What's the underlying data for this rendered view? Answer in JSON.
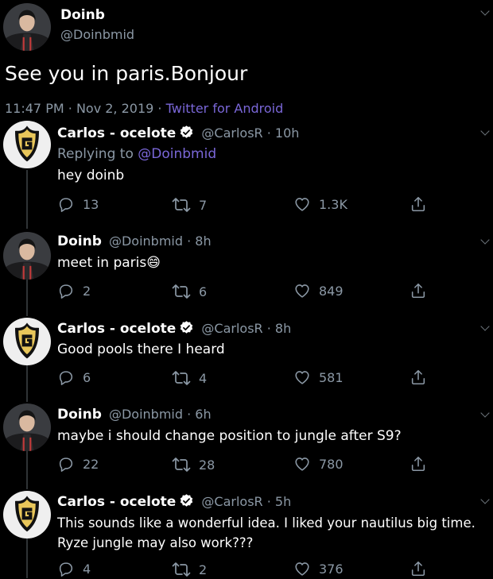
{
  "main_tweet": {
    "name": "Doinb",
    "handle": "@Doinbmid",
    "text": "See you in paris.Bonjour",
    "time": "11:47 PM",
    "date": "Nov 2, 2019",
    "sep": "·",
    "source": "Twitter for Android"
  },
  "replies": [
    {
      "name": "Carlos - ocelote",
      "handle": "@CarlosR",
      "age": "· 10h",
      "replying_prefix": "Replying to",
      "replying_to": "@Doinbmid",
      "text": "hey doinb",
      "reply_count": "13",
      "retweet_count": "7",
      "like_count": "1.3K"
    },
    {
      "name": "Doinb",
      "handle": "@Doinbmid",
      "age": "· 8h",
      "text": "meet in paris😄",
      "reply_count": "2",
      "retweet_count": "6",
      "like_count": "849"
    },
    {
      "name": "Carlos - ocelote",
      "handle": "@CarlosR",
      "age": "· 8h",
      "text": "Good pools there I heard",
      "reply_count": "6",
      "retweet_count": "4",
      "like_count": "581"
    },
    {
      "name": "Doinb",
      "handle": "@Doinbmid",
      "age": "· 6h",
      "text": "maybe i should change position to jungle after S9?",
      "reply_count": "22",
      "retweet_count": "28",
      "like_count": "780"
    },
    {
      "name": "Carlos - ocelote",
      "handle": "@CarlosR",
      "age": "· 5h",
      "text_line1": "This sounds like a wonderful idea. I liked your nautilus big time.",
      "text_line2": "Ryze jungle may also work???",
      "reply_count": "4",
      "retweet_count": "2",
      "like_count": "376"
    }
  ],
  "colors": {
    "background": "#000000",
    "muted": "#8b98a5",
    "link": "#7a67d8",
    "verified": "#ffffff",
    "g2_gold": "#e8c65a"
  },
  "icons": [
    "reply-icon",
    "retweet-icon",
    "like-icon",
    "share-icon",
    "verified-icon",
    "chevron-down-icon"
  ]
}
